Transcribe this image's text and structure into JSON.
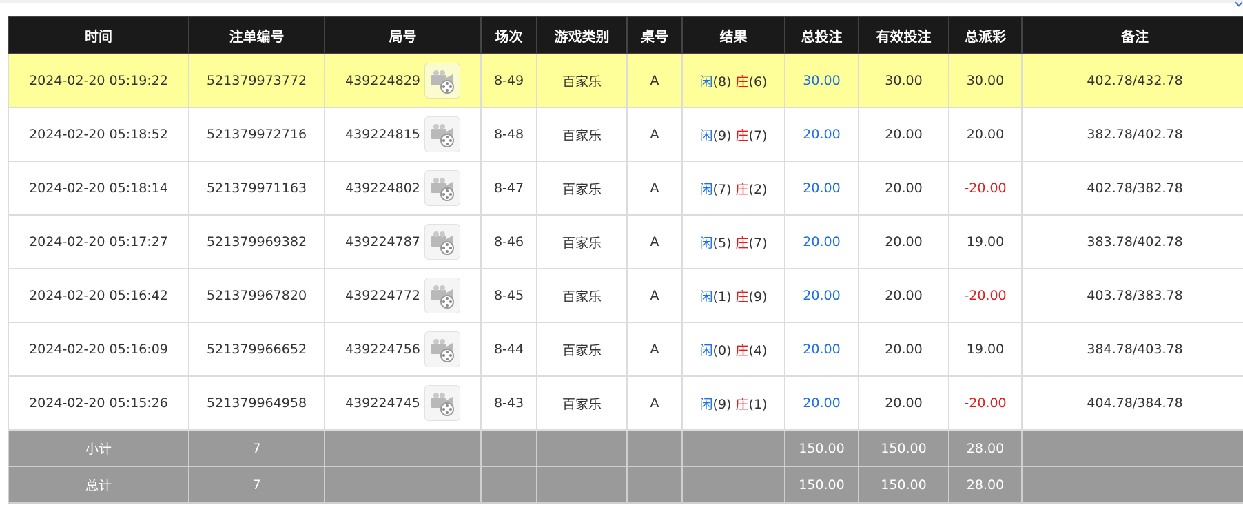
{
  "colors": {
    "header_bg": "#1a1a1a",
    "highlight_row": "#ffff99",
    "footer_bg": "#9a9a9a",
    "player_blue": "#1a6ee6",
    "banker_red": "#e21b1b"
  },
  "headers": [
    "时间",
    "注单编号",
    "局号",
    "场次",
    "游戏类别",
    "桌号",
    "结果",
    "总投注",
    "有效投注",
    "总派彩",
    "备注"
  ],
  "player_label": "闲",
  "banker_label": "庄",
  "rows": [
    {
      "time": "2024-02-20 05:19:22",
      "bet_id": "521379973772",
      "round_id": "439224829",
      "round_icon": "video-replay-icon",
      "session": "8-49",
      "game": "百家乐",
      "table": "A",
      "player_score": "(8)",
      "banker_score": "(6)",
      "total_bet": "30.00",
      "valid_bet": "30.00",
      "payout": "30.00",
      "payout_negative": false,
      "note": "402.78/432.78",
      "highlighted": true
    },
    {
      "time": "2024-02-20 05:18:52",
      "bet_id": "521379972716",
      "round_id": "439224815",
      "round_icon": "video-replay-icon",
      "session": "8-48",
      "game": "百家乐",
      "table": "A",
      "player_score": "(9)",
      "banker_score": "(7)",
      "total_bet": "20.00",
      "valid_bet": "20.00",
      "payout": "20.00",
      "payout_negative": false,
      "note": "382.78/402.78",
      "highlighted": false
    },
    {
      "time": "2024-02-20 05:18:14",
      "bet_id": "521379971163",
      "round_id": "439224802",
      "round_icon": "video-replay-icon",
      "session": "8-47",
      "game": "百家乐",
      "table": "A",
      "player_score": "(7)",
      "banker_score": "(2)",
      "total_bet": "20.00",
      "valid_bet": "20.00",
      "payout": "-20.00",
      "payout_negative": true,
      "note": "402.78/382.78",
      "highlighted": false
    },
    {
      "time": "2024-02-20 05:17:27",
      "bet_id": "521379969382",
      "round_id": "439224787",
      "round_icon": "video-replay-icon",
      "session": "8-46",
      "game": "百家乐",
      "table": "A",
      "player_score": "(5)",
      "banker_score": "(7)",
      "total_bet": "20.00",
      "valid_bet": "20.00",
      "payout": "19.00",
      "payout_negative": false,
      "note": "383.78/402.78",
      "highlighted": false
    },
    {
      "time": "2024-02-20 05:16:42",
      "bet_id": "521379967820",
      "round_id": "439224772",
      "round_icon": "video-replay-icon",
      "session": "8-45",
      "game": "百家乐",
      "table": "A",
      "player_score": "(1)",
      "banker_score": "(9)",
      "total_bet": "20.00",
      "valid_bet": "20.00",
      "payout": "-20.00",
      "payout_negative": true,
      "note": "403.78/383.78",
      "highlighted": false
    },
    {
      "time": "2024-02-20 05:16:09",
      "bet_id": "521379966652",
      "round_id": "439224756",
      "round_icon": "video-replay-icon",
      "session": "8-44",
      "game": "百家乐",
      "table": "A",
      "player_score": "(0)",
      "banker_score": "(4)",
      "total_bet": "20.00",
      "valid_bet": "20.00",
      "payout": "19.00",
      "payout_negative": false,
      "note": "384.78/403.78",
      "highlighted": false
    },
    {
      "time": "2024-02-20 05:15:26",
      "bet_id": "521379964958",
      "round_id": "439224745",
      "round_icon": "video-replay-icon",
      "session": "8-43",
      "game": "百家乐",
      "table": "A",
      "player_score": "(9)",
      "banker_score": "(1)",
      "total_bet": "20.00",
      "valid_bet": "20.00",
      "payout": "-20.00",
      "payout_negative": true,
      "note": "404.78/384.78",
      "highlighted": false
    }
  ],
  "subtotal": {
    "label": "小计",
    "count": "7",
    "total_bet": "150.00",
    "valid_bet": "150.00",
    "payout": "28.00"
  },
  "grand_total": {
    "label": "总计",
    "count": "7",
    "total_bet": "150.00",
    "valid_bet": "150.00",
    "payout": "28.00"
  }
}
